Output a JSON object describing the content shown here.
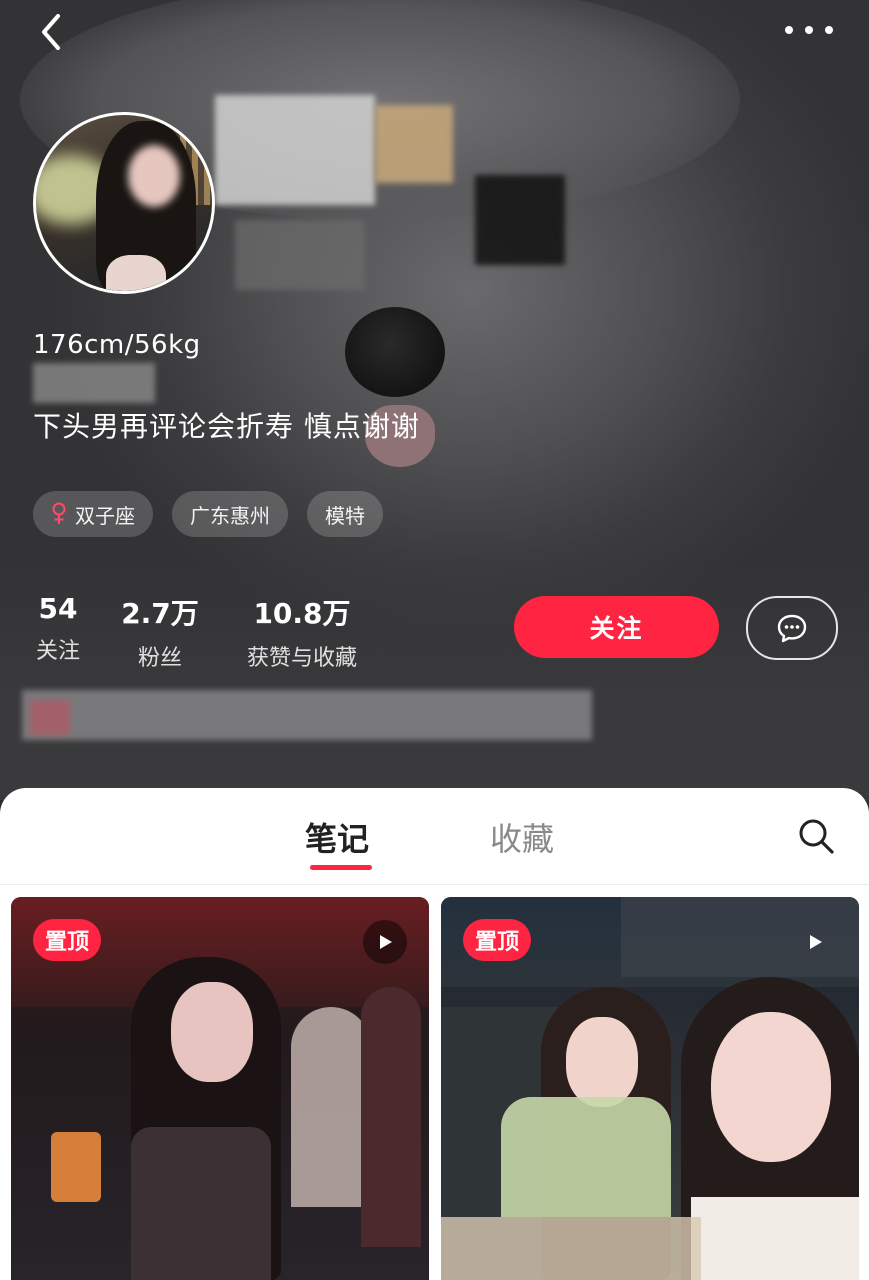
{
  "nav": {
    "back_icon": "chevron-left-icon",
    "more_icon": "more-dots-icon"
  },
  "profile": {
    "height_weight": "176cm/56kg",
    "bio": "下头男再评论会折寿 慎点谢谢",
    "tags": [
      {
        "icon": "female-icon",
        "label": "双子座"
      },
      {
        "label": "广东惠州"
      },
      {
        "label": "模特"
      }
    ]
  },
  "stats": [
    {
      "value": "54",
      "label": "关注"
    },
    {
      "value": "2.7万",
      "label": "粉丝"
    },
    {
      "value": "10.8万",
      "label": "获赞与收藏"
    }
  ],
  "actions": {
    "follow_label": "关注",
    "message_icon": "chat-bubble-icon"
  },
  "tabs": [
    {
      "label": "笔记",
      "active": true
    },
    {
      "label": "收藏",
      "active": false
    }
  ],
  "search_icon": "search-icon",
  "notes": [
    {
      "badge": "置顶",
      "media": "play-icon"
    },
    {
      "badge": "置顶",
      "media": "play-icon"
    }
  ],
  "colors": {
    "accent": "#ff2442",
    "background": "#2e2e30"
  }
}
